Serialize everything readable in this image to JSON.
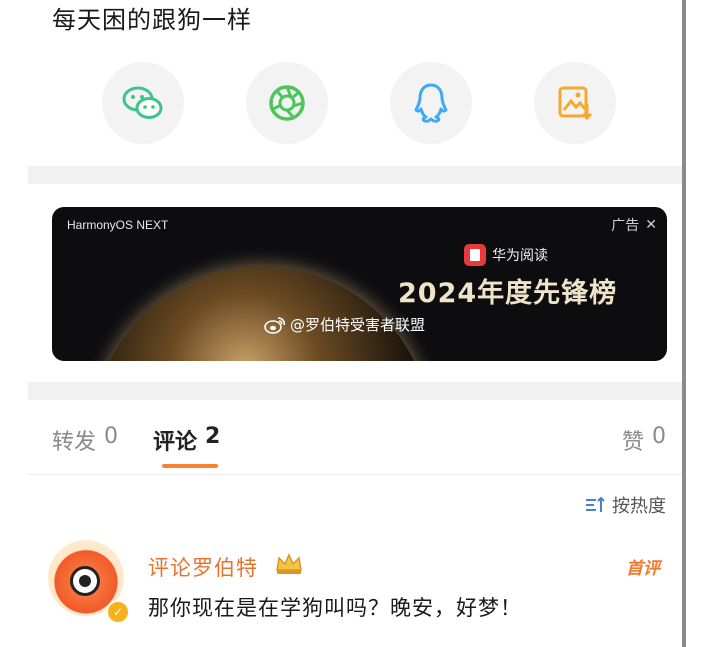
{
  "post": {
    "text": "每天困的跟狗一样"
  },
  "share": {
    "items": [
      {
        "name": "wechat",
        "icon": "wechat-icon",
        "color": "#3fc28b"
      },
      {
        "name": "moments",
        "icon": "aperture-icon",
        "color": "#4cc55a"
      },
      {
        "name": "qq",
        "icon": "qq-penguin-icon",
        "color": "#3fa9f5"
      },
      {
        "name": "save-image",
        "icon": "save-image-icon",
        "color": "#f3a92c"
      }
    ]
  },
  "ad": {
    "brand_os": "HarmonyOS NEXT",
    "label": "广告",
    "app_name": "华为阅读",
    "headline": "2024年度先锋榜",
    "watermark": "@罗伯特受害者联盟"
  },
  "tabs": {
    "repost": {
      "label": "转发",
      "count": "0"
    },
    "comment": {
      "label": "评论",
      "count": "2"
    },
    "like": {
      "label": "赞",
      "count": "0"
    }
  },
  "sort": {
    "label": "按热度"
  },
  "comment": {
    "author": "评论罗伯特",
    "tag": "首评",
    "text": "那你现在是在学狗叫吗？晚安，好梦！"
  },
  "colors": {
    "accent": "#f7822f",
    "name": "#e8742c"
  }
}
